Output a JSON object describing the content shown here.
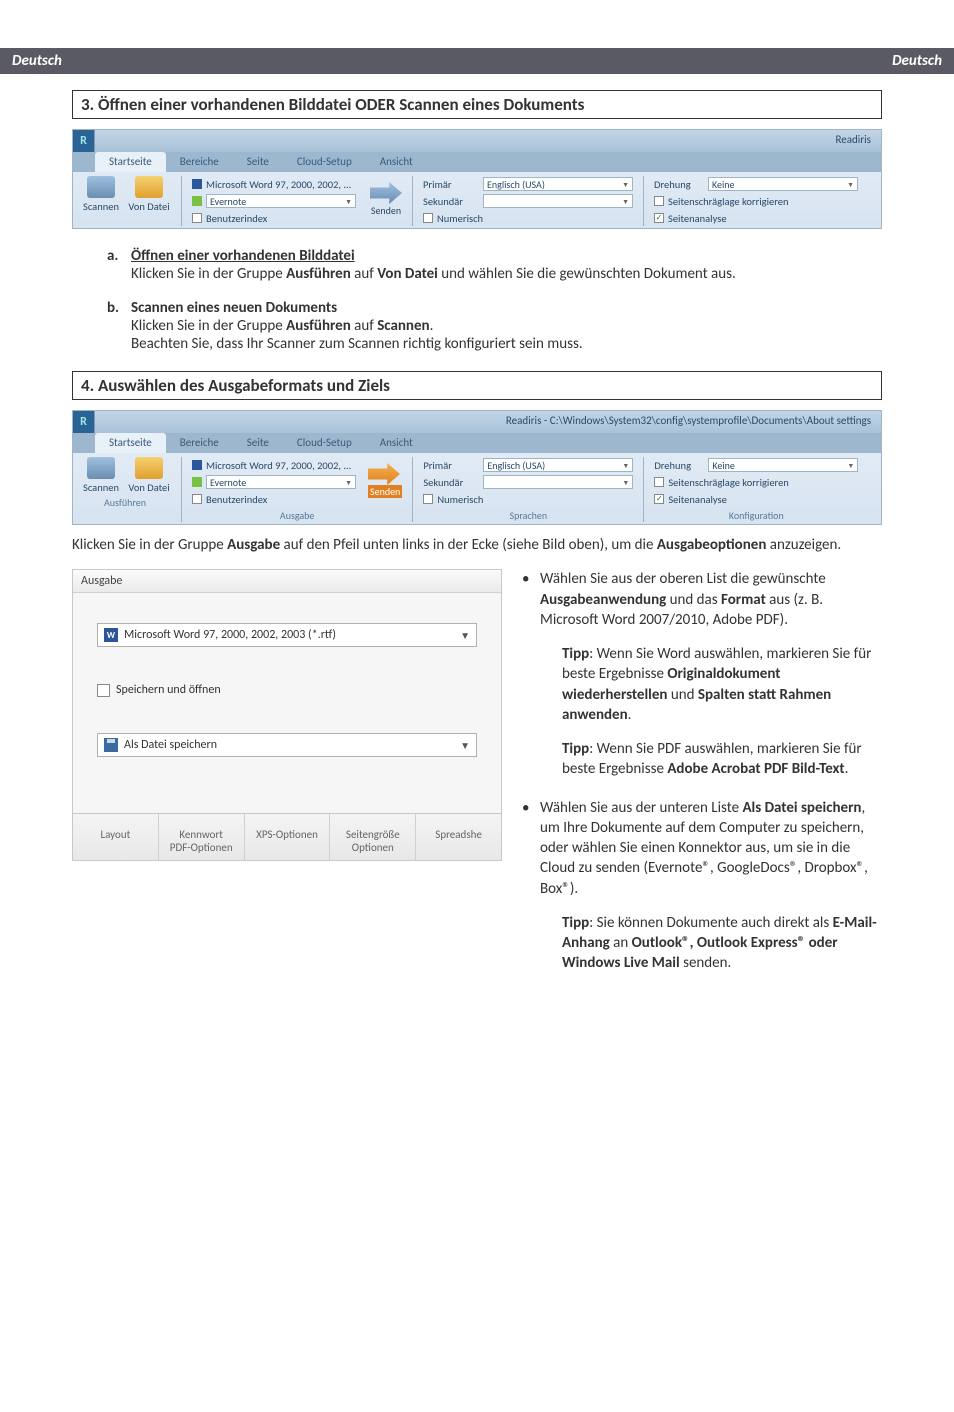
{
  "header": {
    "left": "Deutsch",
    "right": "Deutsch"
  },
  "section3": {
    "title": "3. Öffnen einer vorhandenen Bilddatei ODER Scannen eines Dokuments",
    "a": {
      "title": "Öffnen einer vorhandenen Bilddatei",
      "body": "Klicken Sie in der Gruppe Ausführen auf Von Datei und wählen Sie die gewünschten Dokument aus."
    },
    "b": {
      "title": "Scannen eines neuen Dokuments",
      "body1": "Klicken Sie in der Gruppe Ausführen auf Scannen.",
      "body2": "Beachten Sie, dass Ihr Scanner zum Scannen richtig konfiguriert sein muss."
    }
  },
  "ribbon1": {
    "appTitle": "Readiris",
    "tabs": {
      "home": "Startseite",
      "areas": "Bereiche",
      "page": "Seite",
      "cloud": "Cloud-Setup",
      "view": "Ansicht"
    },
    "exec": {
      "scan": "Scannen",
      "fromFile": "Von Datei"
    },
    "output": {
      "word": "Microsoft Word 97, 2000, 2002, ...",
      "evernote": "Evernote",
      "userindex": "Benutzerindex",
      "send": "Senden"
    },
    "lang": {
      "primary": "Primär",
      "secondary": "Sekundär",
      "numeric": "Numerisch",
      "primaryVal": "Englisch (USA)"
    },
    "conf": {
      "rotation": "Drehung",
      "rotationVal": "Keine",
      "deskew": "Seitenschräglage korrigieren",
      "pageAnalysis": "Seitenanalyse"
    }
  },
  "section4": {
    "title": "4. Auswählen des Ausgabeformats und Ziels"
  },
  "ribbon2": {
    "appTitle": "Readiris - C:\\Windows\\System32\\config\\systemprofile\\Documents\\About settings",
    "execLabel": "Ausführen",
    "outputLabel": "Ausgabe",
    "langLabel": "Sprachen",
    "confLabel": "Konfiguration"
  },
  "para4": "Klicken Sie in der Gruppe Ausgabe auf den Pfeil unten links in der Ecke (siehe Bild oben), um die Ausgabeoptionen anzuzeigen.",
  "ausgabePanel": {
    "title": "Ausgabe",
    "format": "Microsoft Word 97, 2000, 2002, 2003 (*.rtf)",
    "saveOpen": "Speichern und öffnen",
    "saveAs": "Als Datei speichern",
    "tabs": {
      "layout": "Layout",
      "pwd": "Kennwort\nPDF-Optionen",
      "xps": "XPS-Optionen",
      "size": "Seitengröße\nOptionen",
      "spread": "Spreadshe"
    }
  },
  "right": {
    "bullet1": "Wählen Sie aus der oberen List die gewünschte Ausgabeanwendung und das Format aus (z. B. Microsoft Word 2007/2010, Adobe PDF).",
    "tip1": "Tipp: Wenn Sie Word auswählen, markieren Sie für beste Ergebnisse Originaldokument wiederherstellen und Spalten statt Rahmen anwenden.",
    "tip2": "Tipp: Wenn Sie PDF auswählen, markieren Sie für beste Ergebnisse Adobe Acrobat PDF Bild-Text.",
    "bullet2": "Wählen Sie aus der unteren Liste Als Datei speichern, um Ihre Dokumente auf dem Computer zu speichern, oder wählen Sie einen Konnektor aus, um sie in die Cloud zu senden (Evernote®, GoogleDocs®, Dropbox®, Box®).",
    "tip3": "Tipp: Sie können Dokumente auch direkt als E-Mail-Anhang an Outlook®, Outlook Express® oder Windows Live Mail senden."
  }
}
